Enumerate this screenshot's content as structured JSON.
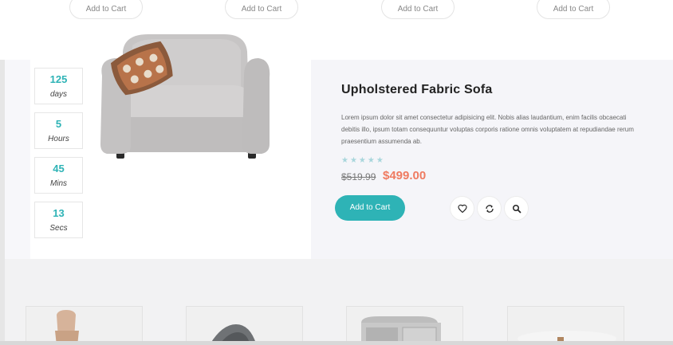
{
  "top_products": [
    {
      "cart_label": "Add to Cart"
    },
    {
      "cart_label": "Add to Cart"
    },
    {
      "cart_label": "Add to Cart"
    },
    {
      "cart_label": "Add to Cart"
    }
  ],
  "countdown": [
    {
      "value": "125",
      "unit": "days"
    },
    {
      "value": "5",
      "unit": "Hours"
    },
    {
      "value": "45",
      "unit": "Mins"
    },
    {
      "value": "13",
      "unit": "Secs"
    }
  ],
  "product": {
    "title": "Upholstered Fabric Sofa",
    "description": "Lorem ipsum dolor sit amet consectetur adipisicing elit. Nobis alias laudantium, enim facilis obcaecati debitis illo, ipsum totam consequuntur voluptas corporis ratione omnis voluptatem at repudiandae rerum praesentium assumenda ab.",
    "rating": 0,
    "rating_max": 5,
    "stars": "★★★★★",
    "old_price": "$519.99",
    "new_price": "$499.00",
    "add_to_cart": "Add to Cart",
    "actions": [
      "heart-icon",
      "refresh-icon",
      "search-icon"
    ]
  },
  "colors": {
    "accent": "#2eb3b6",
    "sale_price": "#ef7b61",
    "star_inactive": "#a8d6dc"
  },
  "bottom_thumbnails": [
    "chair-thumbnail",
    "round-chair-thumbnail",
    "cabinet-thumbnail",
    "table-thumbnail"
  ]
}
